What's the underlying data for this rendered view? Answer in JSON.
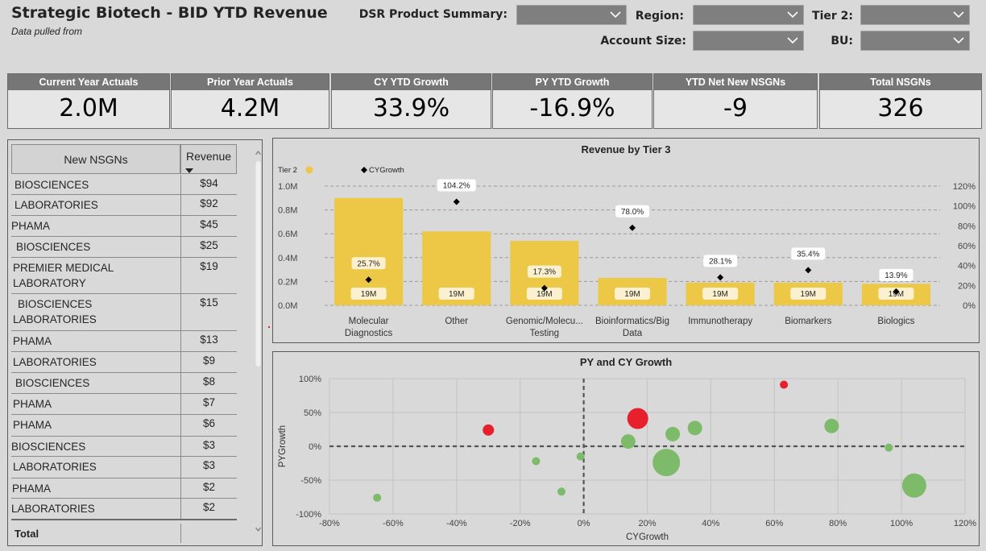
{
  "header": {
    "title": "Strategic Biotech - BID YTD Revenue",
    "subtitle": "Data pulled from"
  },
  "filters": {
    "dsr": "DSR Product Summary:",
    "region": "Region:",
    "tier2": "Tier 2:",
    "account_size": "Account Size:",
    "bu": "BU:"
  },
  "kpis": [
    {
      "label": "Current Year Actuals",
      "value": "2.0M"
    },
    {
      "label": "Prior Year Actuals",
      "value": "4.2M"
    },
    {
      "label": "CY YTD Growth",
      "value": "33.9%"
    },
    {
      "label": "PY YTD Growth",
      "value": "-16.9%"
    },
    {
      "label": "YTD Net New NSGNs",
      "value": "-9"
    },
    {
      "label": "Total NSGNs",
      "value": "326"
    }
  ],
  "table": {
    "col1": "New NSGNs",
    "col2": "Revenue",
    "rows": [
      {
        "name": "BIOSCIENCES",
        "value": "$94"
      },
      {
        "name": "LABORATORIES",
        "value": "$92"
      },
      {
        "name": "PHAMA",
        "value": "$45"
      },
      {
        "name": "BIOSCIENCES",
        "value": "$25"
      },
      {
        "name": "PREMIER MEDICAL LABORATORY",
        "value": "$19"
      },
      {
        "name": "BIOSCIENCES LABORATORIES",
        "value": "$15"
      },
      {
        "name": "PHAMA",
        "value": "$13"
      },
      {
        "name": "LABORATORIES",
        "value": "$9"
      },
      {
        "name": "BIOSCIENCES",
        "value": "$8"
      },
      {
        "name": "PHAMA",
        "value": "$7"
      },
      {
        "name": "PHAMA",
        "value": "$6"
      },
      {
        "name": "BIOSCIENCES",
        "value": "$3"
      },
      {
        "name": "LABORATORIES",
        "value": "$3"
      },
      {
        "name": "PHAMA",
        "value": "$2"
      },
      {
        "name": "LABORATORIES",
        "value": "$2"
      }
    ],
    "total_label": "Total"
  },
  "chart_data": [
    {
      "type": "bar",
      "title": "Revenue by Tier 3",
      "legend": {
        "bar_series": "Tier 2",
        "marker_series": "CYGrowth",
        "placement": "top-left"
      },
      "categories": [
        "Molecular Diagnostics",
        "Other",
        "Genomic/Molecu... Testing",
        "Bioinformatics/Big Data",
        "Immunotherapy",
        "Biomarkers",
        "Biologics"
      ],
      "series": [
        {
          "name": "Tier 2",
          "axis": "left",
          "values": [
            0.9,
            0.62,
            0.54,
            0.23,
            0.19,
            0.19,
            0.18
          ],
          "data_labels": [
            "19M",
            "19M",
            "19M",
            "19M",
            "19M",
            "19M",
            "19M"
          ]
        },
        {
          "name": "CYGrowth",
          "axis": "right",
          "values": [
            25.7,
            104.2,
            17.3,
            78.0,
            28.1,
            35.4,
            13.9
          ],
          "data_labels": [
            "25.7%",
            "104.2%",
            "17.3%",
            "78.0%",
            "28.1%",
            "35.4%",
            "13.9%"
          ]
        }
      ],
      "y_left": {
        "ticks": [
          "0.0M",
          "0.2M",
          "0.4M",
          "0.6M",
          "0.8M",
          "1.0M"
        ],
        "ylim": [
          0,
          1.0
        ]
      },
      "y_right": {
        "ticks": [
          "0%",
          "20%",
          "40%",
          "60%",
          "80%",
          "100%",
          "120%"
        ],
        "ylim": [
          0,
          120
        ]
      },
      "colors": {
        "bar": "#ecc846",
        "marker": "#000000"
      }
    },
    {
      "type": "scatter",
      "title": "PY and CY Growth",
      "xlabel": "CYGrowth",
      "ylabel": "PYGrowth",
      "xlim": [
        -80,
        120
      ],
      "ylim": [
        -100,
        100
      ],
      "x_ticks": [
        "-80%",
        "-60%",
        "-40%",
        "-20%",
        "0%",
        "20%",
        "40%",
        "60%",
        "80%",
        "100%",
        "120%"
      ],
      "y_ticks": [
        "100%",
        "50%",
        "0%",
        "-50%",
        "-100%"
      ],
      "grid": true,
      "colors": {
        "positive": "#7dbb6a",
        "negative": "#e8202e"
      },
      "points": [
        {
          "x": -30,
          "y": 24,
          "size": 7,
          "color": "negative"
        },
        {
          "x": 17,
          "y": 41,
          "size": 13,
          "color": "negative"
        },
        {
          "x": 63,
          "y": 91,
          "size": 5,
          "color": "negative"
        },
        {
          "x": -65,
          "y": -76,
          "size": 5,
          "color": "positive"
        },
        {
          "x": -15,
          "y": -22,
          "size": 5,
          "color": "positive"
        },
        {
          "x": -7,
          "y": -67,
          "size": 5,
          "color": "positive"
        },
        {
          "x": -1,
          "y": -15,
          "size": 5,
          "color": "positive"
        },
        {
          "x": 14,
          "y": 7,
          "size": 9,
          "color": "positive"
        },
        {
          "x": 26,
          "y": -24,
          "size": 17,
          "color": "positive"
        },
        {
          "x": 28,
          "y": 18,
          "size": 9,
          "color": "positive"
        },
        {
          "x": 35,
          "y": 27,
          "size": 9,
          "color": "positive"
        },
        {
          "x": 78,
          "y": 30,
          "size": 9,
          "color": "positive"
        },
        {
          "x": 96,
          "y": -2,
          "size": 5,
          "color": "positive"
        },
        {
          "x": 104,
          "y": -58,
          "size": 15,
          "color": "positive"
        }
      ]
    }
  ]
}
